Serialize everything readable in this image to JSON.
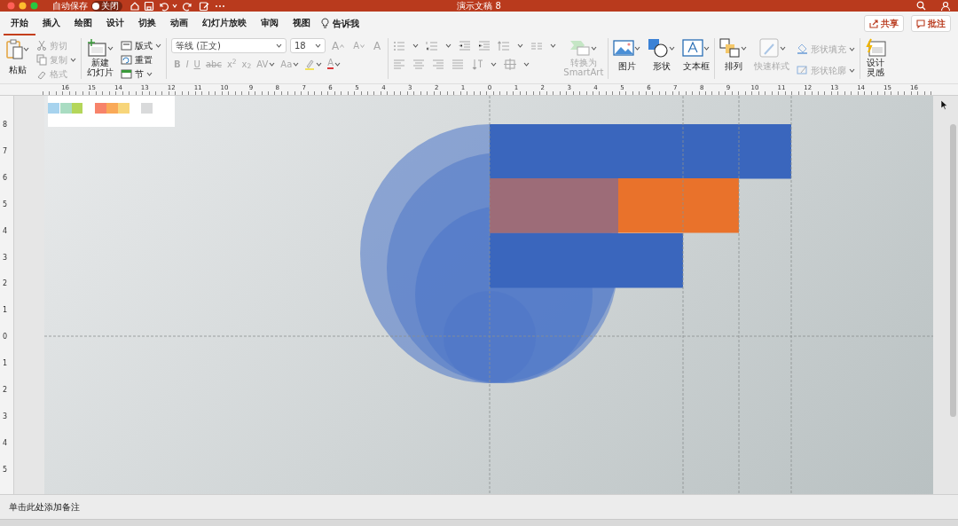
{
  "window": {
    "title": "演示文稿 8"
  },
  "quick_access": {
    "autosave_label": "自动保存",
    "autosave": {
      "on": false,
      "label": "关闭"
    }
  },
  "tabs": [
    {
      "label": "开始",
      "selected": true
    },
    {
      "label": "插入",
      "selected": false
    },
    {
      "label": "绘图",
      "selected": false
    },
    {
      "label": "设计",
      "selected": false
    },
    {
      "label": "切换",
      "selected": false
    },
    {
      "label": "动画",
      "selected": false
    },
    {
      "label": "幻灯片放映",
      "selected": false
    },
    {
      "label": "审阅",
      "selected": false
    },
    {
      "label": "视图",
      "selected": false
    }
  ],
  "tell_me": "告诉我",
  "share": "共享",
  "comments": "批注",
  "ribbon": {
    "paste": "粘贴",
    "clipboard": [
      {
        "label": "剪切",
        "disabled": true
      },
      {
        "label": "复制",
        "disabled": true
      },
      {
        "label": "格式",
        "disabled": true
      }
    ],
    "new_slide": [
      "新建",
      "幻灯片"
    ],
    "slide_items": [
      {
        "label": "版式",
        "dropdown": true
      },
      {
        "label": "重置",
        "dropdown": false
      },
      {
        "label": "节",
        "dropdown": true
      }
    ],
    "font_name": "等线 (正文)",
    "font_size": "18",
    "font_row1": [
      {
        "kind": "grow",
        "label": "A"
      },
      {
        "kind": "shrink",
        "label": "A"
      },
      {
        "kind": "clear",
        "label": "A"
      }
    ],
    "font_row2": [
      {
        "kind": "bold",
        "label": "B"
      },
      {
        "kind": "italic",
        "label": "I"
      },
      {
        "kind": "underline",
        "label": "U"
      },
      {
        "kind": "strike",
        "label": "abc"
      },
      {
        "kind": "plain",
        "label": "x$^{2}$"
      },
      {
        "kind": "plain",
        "label": "x$_{2}$"
      },
      {
        "kind": "caret",
        "label": "AV"
      },
      {
        "kind": "caret",
        "label": "Aa"
      },
      {
        "kind": "highlight"
      },
      {
        "kind": "color",
        "label": "A"
      }
    ],
    "font_disabled": true,
    "smartart": {
      "label": [
        "转换为",
        "SmartArt"
      ],
      "disabled": true
    },
    "insert": [
      {
        "kind": "picture",
        "label": "图片"
      },
      {
        "kind": "shape",
        "label": "形状"
      },
      {
        "kind": "textbox",
        "label": "文本框"
      }
    ],
    "arrange": "排列",
    "quick_styles": {
      "label": "快速样式",
      "disabled": true
    },
    "shape_items": [
      {
        "kind": "fill",
        "label": "形状填充",
        "disabled": true
      },
      {
        "kind": "outline",
        "label": "形状轮廓",
        "disabled": true
      }
    ],
    "designer": [
      "设计",
      "灵感"
    ]
  },
  "ruler": {
    "labels": [
      "16",
      "15",
      "14",
      "13",
      "12",
      "11",
      "10",
      "9",
      "8",
      "7",
      "6",
      "5",
      "4",
      "3",
      "2",
      "1",
      "0",
      "1",
      "2",
      "3",
      "4",
      "5",
      "6",
      "7",
      "8",
      "9",
      "10",
      "11",
      "12",
      "13",
      "14",
      "15",
      "16"
    ],
    "vertical_labels": [
      "8",
      "7",
      "6",
      "5",
      "4",
      "3",
      "2",
      "1",
      "0",
      "1",
      "2",
      "3",
      "4",
      "5"
    ]
  },
  "slide": {
    "swatches": [
      {
        "color": "#a7d3ee"
      },
      {
        "color": "#a9dcc2"
      },
      {
        "color": "#b4d65a"
      },
      {
        "color": "#f7836a"
      },
      {
        "color": "#f9a958"
      },
      {
        "color": "#f7d57a"
      },
      {
        "color": "#d9dadb"
      }
    ],
    "bars": [
      {
        "color": "#3a66bd"
      },
      {
        "color": "#e9722b"
      },
      {
        "color": "#3a66bd"
      }
    ]
  },
  "notes": {
    "placeholder": "单击此处添加备注"
  }
}
